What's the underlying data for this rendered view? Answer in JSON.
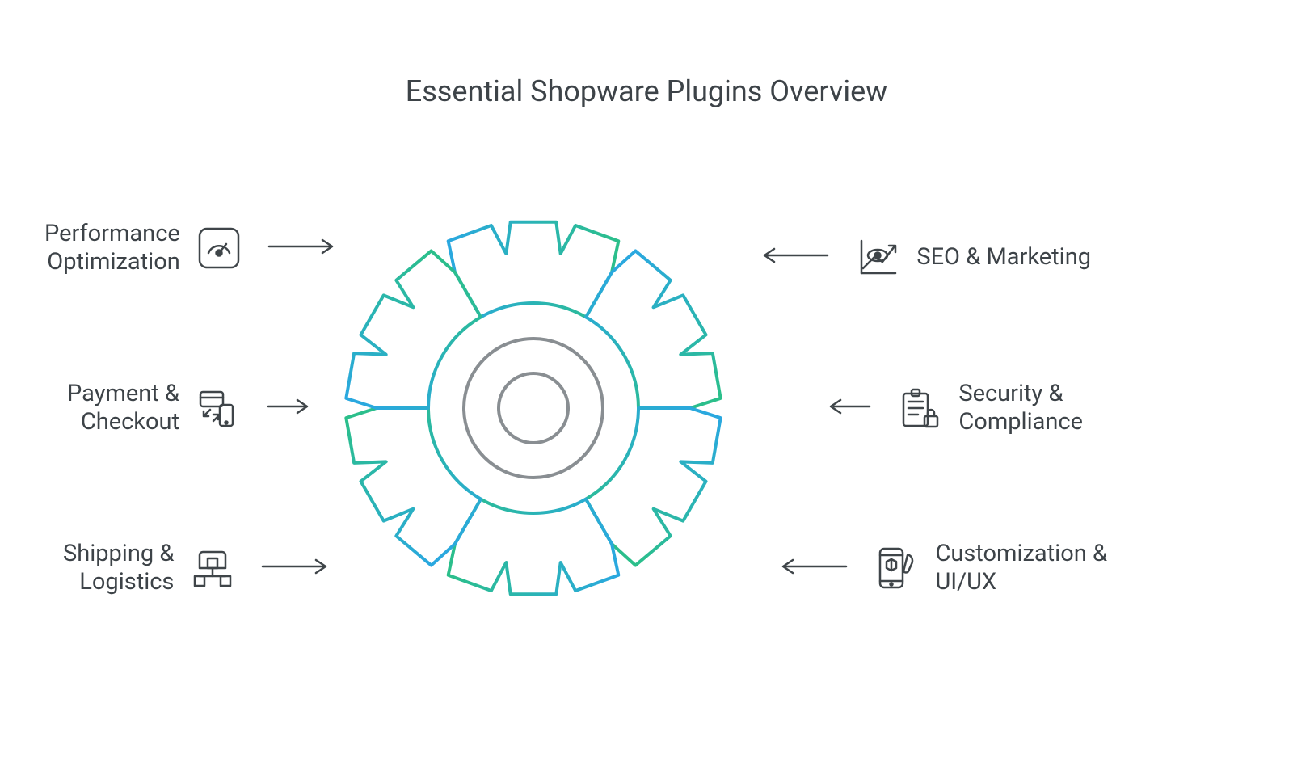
{
  "title": "Essential Shopware Plugins Overview",
  "left": [
    {
      "label": "Performance\nOptimization",
      "icon": "gauge-icon"
    },
    {
      "label": "Payment &\nCheckout",
      "icon": "payment-icon"
    },
    {
      "label": "Shipping &\nLogistics",
      "icon": "warehouse-icon"
    }
  ],
  "right": [
    {
      "label": "SEO & Marketing",
      "icon": "seo-icon"
    },
    {
      "label": "Security &\nCompliance",
      "icon": "compliance-icon"
    },
    {
      "label": "Customization &\nUI/UX",
      "icon": "customize-icon"
    }
  ],
  "colors": {
    "seg1": "#2aa8e0",
    "seg2": "#2bbf8a",
    "seg3": "#e0c72a",
    "seg4": "#e05a3a",
    "seg5": "#e08a2a",
    "seg6": "#8bbf2a"
  }
}
